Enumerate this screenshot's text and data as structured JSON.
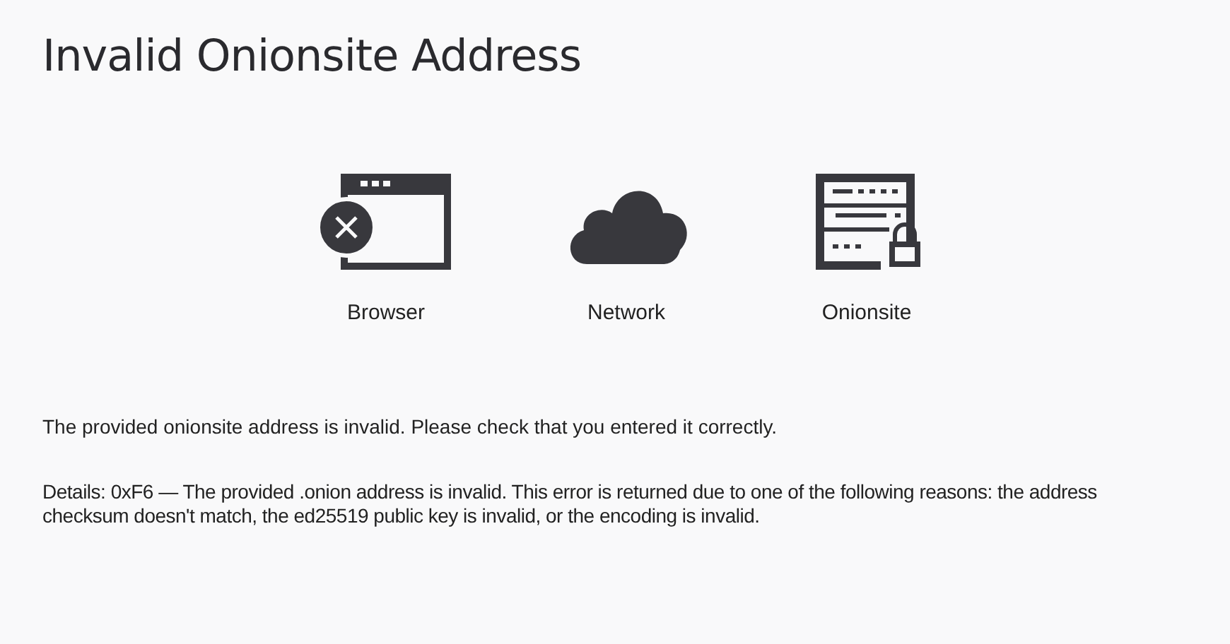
{
  "title": "Invalid Onionsite Address",
  "nodes": [
    {
      "kind": "browser",
      "label": "Browser",
      "error": true
    },
    {
      "kind": "network",
      "label": "Network",
      "error": false
    },
    {
      "kind": "onionsite",
      "label": "Onionsite",
      "error": false
    }
  ],
  "message": "The provided onionsite address is invalid. Please check that you entered it correctly.",
  "details": "Details: 0xF6 — The provided .onion address is invalid. This error is returned due to one of the following reasons: the address checksum doesn't match, the ed25519 public key is invalid, or the encoding is invalid."
}
